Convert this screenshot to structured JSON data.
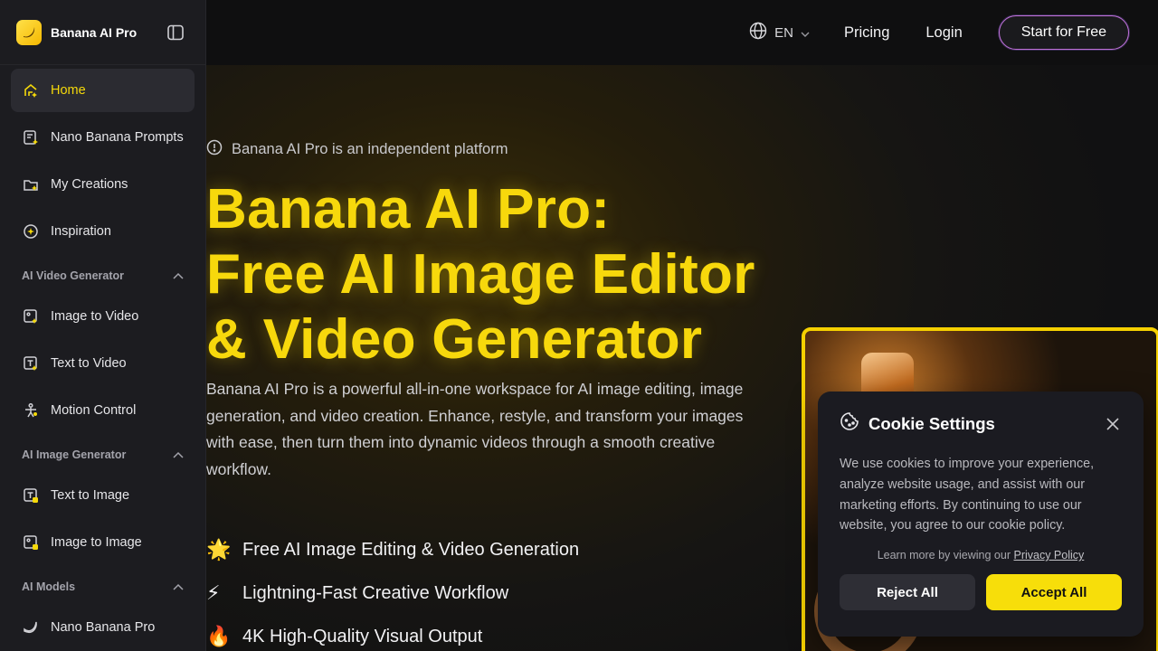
{
  "brand": {
    "name": "Banana AI Pro",
    "icon": "banana-logo-icon",
    "accent": "#f7d80c"
  },
  "sidebar": {
    "top_items": [
      {
        "label": "Home",
        "icon": "home-sparkle-icon",
        "active": true
      },
      {
        "label": "Nano Banana Prompts",
        "icon": "prompt-list-icon"
      },
      {
        "label": "My Creations",
        "icon": "folder-image-icon"
      },
      {
        "label": "Inspiration",
        "icon": "inspiration-icon"
      }
    ],
    "sections": [
      {
        "title": "AI Video Generator",
        "items": [
          {
            "label": "Image to Video",
            "icon": "image-video-icon"
          },
          {
            "label": "Text to Video",
            "icon": "text-video-icon"
          },
          {
            "label": "Motion Control",
            "icon": "motion-figure-icon"
          }
        ]
      },
      {
        "title": "AI Image Generator",
        "items": [
          {
            "label": "Text to Image",
            "icon": "text-image-icon"
          },
          {
            "label": "Image to Image",
            "icon": "image-image-icon"
          }
        ]
      },
      {
        "title": "AI Models",
        "items": [
          {
            "label": "Nano Banana Pro",
            "icon": "banana-outline-icon"
          }
        ]
      }
    ]
  },
  "topbar": {
    "language": "EN",
    "pricing": "Pricing",
    "login": "Login",
    "cta": "Start for Free"
  },
  "hero": {
    "notice": "Banana AI Pro is an independent platform",
    "title_lines": [
      "Banana AI Pro:",
      "Free AI Image Editor",
      "& Video Generator"
    ],
    "description": "Banana AI Pro is a powerful all-in-one workspace for AI image editing, image generation, and video creation. Enhance, restyle, and transform your images with ease, then turn them into dynamic videos through a smooth creative workflow.",
    "features": [
      {
        "emoji": "🌟",
        "text": "Free AI Image Editing & Video Generation"
      },
      {
        "emoji": "⚡",
        "text": "Lightning-Fast Creative Workflow"
      },
      {
        "emoji": "🔥",
        "text": "4K High-Quality Visual Output"
      }
    ]
  },
  "cookie": {
    "title": "Cookie Settings",
    "text": "We use cookies to improve your experience, analyze website usage, and assist with our marketing efforts. By continuing to use our website, you agree to our cookie policy.",
    "more_prefix": "Learn more by viewing our ",
    "more_link": "Privacy Policy",
    "reject": "Reject All",
    "accept": "Accept All"
  }
}
